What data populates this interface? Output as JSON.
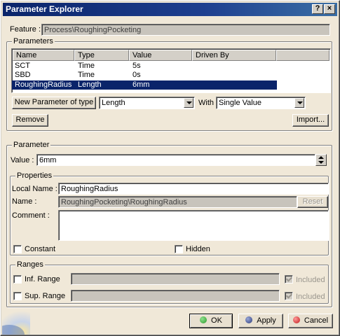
{
  "window": {
    "title": "Parameter Explorer",
    "help_btn": "?",
    "close_btn": "×"
  },
  "feature": {
    "label": "Feature :",
    "value": "Process\\RoughingPocketing"
  },
  "parameters": {
    "group_title": "Parameters",
    "columns": [
      "Name",
      "Type",
      "Value",
      "Driven By"
    ],
    "rows": [
      {
        "name": "SCT",
        "type": "Time",
        "value": "5s",
        "driven_by": ""
      },
      {
        "name": "SBD",
        "type": "Time",
        "value": "0s",
        "driven_by": ""
      },
      {
        "name": "RoughingRadius",
        "type": "Length",
        "value": "6mm",
        "driven_by": ""
      }
    ],
    "selected_row": 2,
    "new_param_btn": "New Parameter of type",
    "type_select": "Length",
    "with_label": "With",
    "with_select": "Single Value",
    "remove_btn": "Remove",
    "import_btn": "Import..."
  },
  "parameter": {
    "group_title": "Parameter",
    "value_label": "Value :",
    "value": "6mm"
  },
  "properties": {
    "group_title": "Properties",
    "local_name_label": "Local Name :",
    "local_name": "RoughingRadius",
    "name_label": "Name :",
    "name": "RoughingPocketing\\RoughingRadius",
    "reset_btn": "Reset",
    "comment_label": "Comment :",
    "comment": "",
    "constant_label": "Constant",
    "hidden_label": "Hidden"
  },
  "ranges": {
    "group_title": "Ranges",
    "inf_label": "Inf. Range",
    "sup_label": "Sup. Range",
    "inf_value": "",
    "sup_value": "",
    "included_label": "Included"
  },
  "footer": {
    "ok": "OK",
    "apply": "Apply",
    "cancel": "Cancel"
  },
  "colors": {
    "ok": "#2a9a2a",
    "apply": "#3a4a8a",
    "cancel": "#d02020",
    "titlebar": "#0a246a"
  }
}
